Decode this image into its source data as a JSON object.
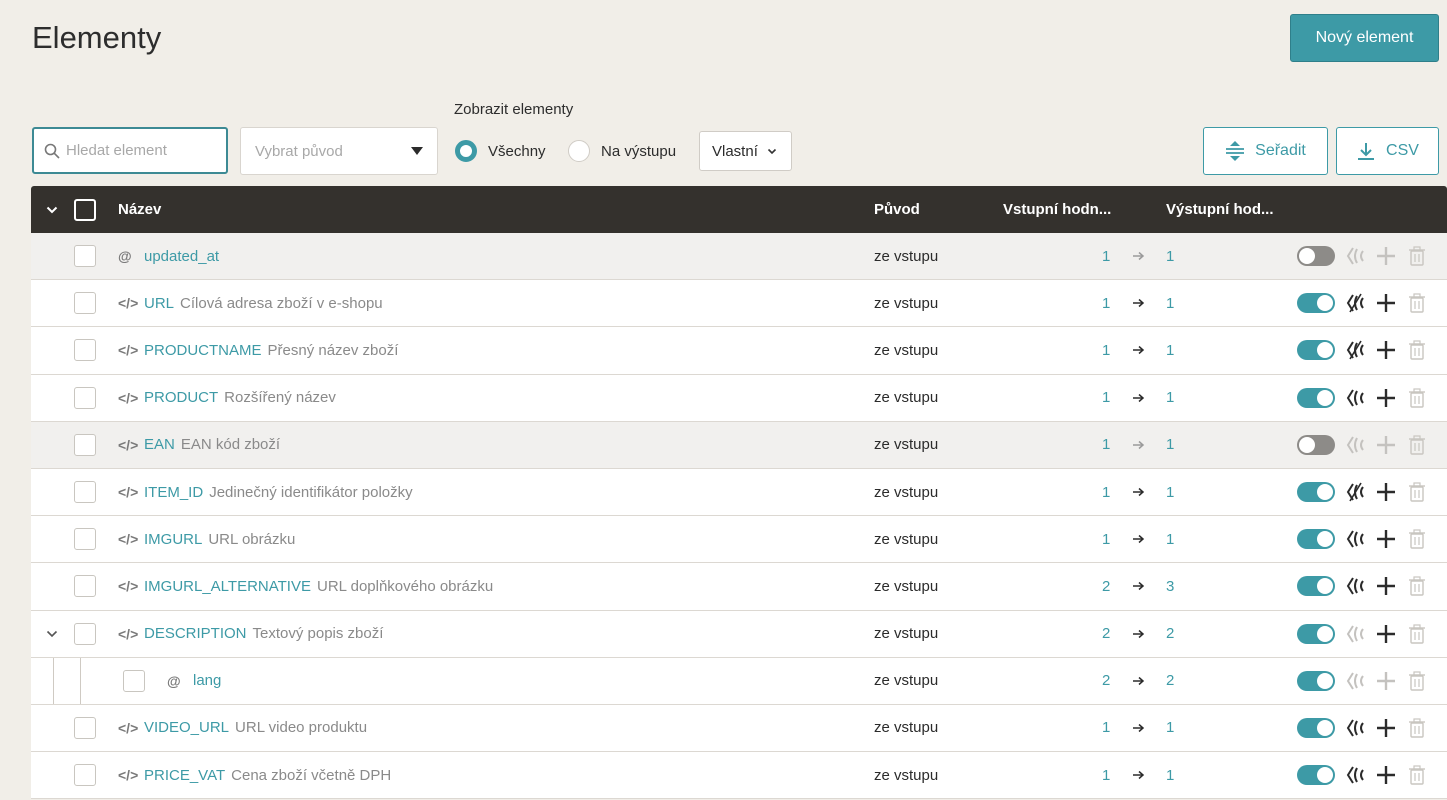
{
  "page": {
    "title": "Elementy",
    "new_button": "Nový element"
  },
  "filters": {
    "search_placeholder": "Hledat element",
    "origin_placeholder": "Vybrat původ",
    "show_label": "Zobrazit elementy",
    "radio_all": "Všechny",
    "radio_output": "Na výstupu",
    "custom_select": "Vlastní",
    "sort_button": "Seřadit",
    "csv_button": "CSV"
  },
  "table": {
    "headers": {
      "name": "Název",
      "origin": "Původ",
      "input": "Vstupní hodn...",
      "output": "Výstupní hod..."
    },
    "rows": [
      {
        "type": "@",
        "name": "updated_at",
        "desc": "",
        "origin": "ze vstupu",
        "in": "1",
        "out": "1",
        "enabled": false,
        "transform_active": false,
        "add_active": false
      },
      {
        "type": "</>",
        "name": "URL",
        "desc": "Cílová adresa zboží v e-shopu",
        "origin": "ze vstupu",
        "in": "1",
        "out": "1",
        "enabled": true,
        "transform_active": true,
        "add_active": true
      },
      {
        "type": "</>",
        "name": "PRODUCTNAME",
        "desc": "Přesný název zboží",
        "origin": "ze vstupu",
        "in": "1",
        "out": "1",
        "enabled": true,
        "transform_active": true,
        "add_active": true
      },
      {
        "type": "</>",
        "name": "PRODUCT",
        "desc": "Rozšířený název",
        "origin": "ze vstupu",
        "in": "1",
        "out": "1",
        "enabled": true,
        "transform_active": true,
        "add_active": true
      },
      {
        "type": "</>",
        "name": "EAN",
        "desc": "EAN kód zboží",
        "origin": "ze vstupu",
        "in": "1",
        "out": "1",
        "enabled": false,
        "transform_active": false,
        "add_active": false
      },
      {
        "type": "</>",
        "name": "ITEM_ID",
        "desc": "Jedinečný identifikátor položky",
        "origin": "ze vstupu",
        "in": "1",
        "out": "1",
        "enabled": true,
        "transform_active": true,
        "add_active": true
      },
      {
        "type": "</>",
        "name": "IMGURL",
        "desc": "URL obrázku",
        "origin": "ze vstupu",
        "in": "1",
        "out": "1",
        "enabled": true,
        "transform_active": true,
        "add_active": true
      },
      {
        "type": "</>",
        "name": "IMGURL_ALTERNATIVE",
        "desc": "URL doplňkového obrázku",
        "origin": "ze vstupu",
        "in": "2",
        "out": "3",
        "enabled": true,
        "transform_active": true,
        "add_active": true
      },
      {
        "type": "</>",
        "name": "DESCRIPTION",
        "desc": "Textový popis zboží",
        "origin": "ze vstupu",
        "in": "2",
        "out": "2",
        "enabled": true,
        "transform_active": false,
        "add_active": true,
        "expandable": true
      },
      {
        "type": "@",
        "name": "lang",
        "desc": "",
        "origin": "ze vstupu",
        "in": "2",
        "out": "2",
        "enabled": true,
        "transform_active": false,
        "add_active": false,
        "child": true
      },
      {
        "type": "</>",
        "name": "VIDEO_URL",
        "desc": "URL video produktu",
        "origin": "ze vstupu",
        "in": "1",
        "out": "1",
        "enabled": true,
        "transform_active": true,
        "add_active": true
      },
      {
        "type": "</>",
        "name": "PRICE_VAT",
        "desc": "Cena zboží včetně DPH",
        "origin": "ze vstupu",
        "in": "1",
        "out": "1",
        "enabled": true,
        "transform_active": true,
        "add_active": true
      }
    ]
  },
  "icons": {
    "search": "search-icon",
    "sort": "sort-icon",
    "download": "download-icon",
    "toggle": "toggle-switch",
    "transform": "transform-icon",
    "add": "plus-icon",
    "delete": "trash-icon"
  },
  "colors": {
    "accent": "#3d9aa6",
    "header_bg": "#34312d",
    "page_bg": "#f1eee8"
  }
}
